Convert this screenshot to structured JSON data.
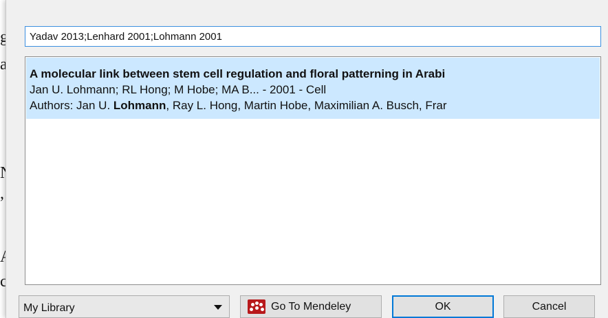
{
  "search": {
    "value": "Yadav 2013;Lenhard 2001;Lohmann 2001"
  },
  "results": [
    {
      "title": "A molecular link between stem cell regulation and floral patterning in Arabi",
      "meta": "Jan U. Lohmann; RL Hong; M Hobe; MA B... - 2001 - Cell",
      "authors_prefix": "Authors: Jan U. ",
      "authors_highlight": "Lohmann",
      "authors_suffix": ", Ray L. Hong, Martin Hobe, Maximilian A. Busch, Frar"
    }
  ],
  "library": {
    "selected": "My Library"
  },
  "buttons": {
    "mendeley": "Go To Mendeley",
    "ok": "OK",
    "cancel": "Cancel"
  },
  "background_doc": {
    "chars": [
      "g",
      "a",
      "N",
      ",",
      "A",
      "c"
    ]
  },
  "colors": {
    "selection": "#cce8ff",
    "focus_border": "#0078d7",
    "mendeley_red": "#b8191b"
  }
}
